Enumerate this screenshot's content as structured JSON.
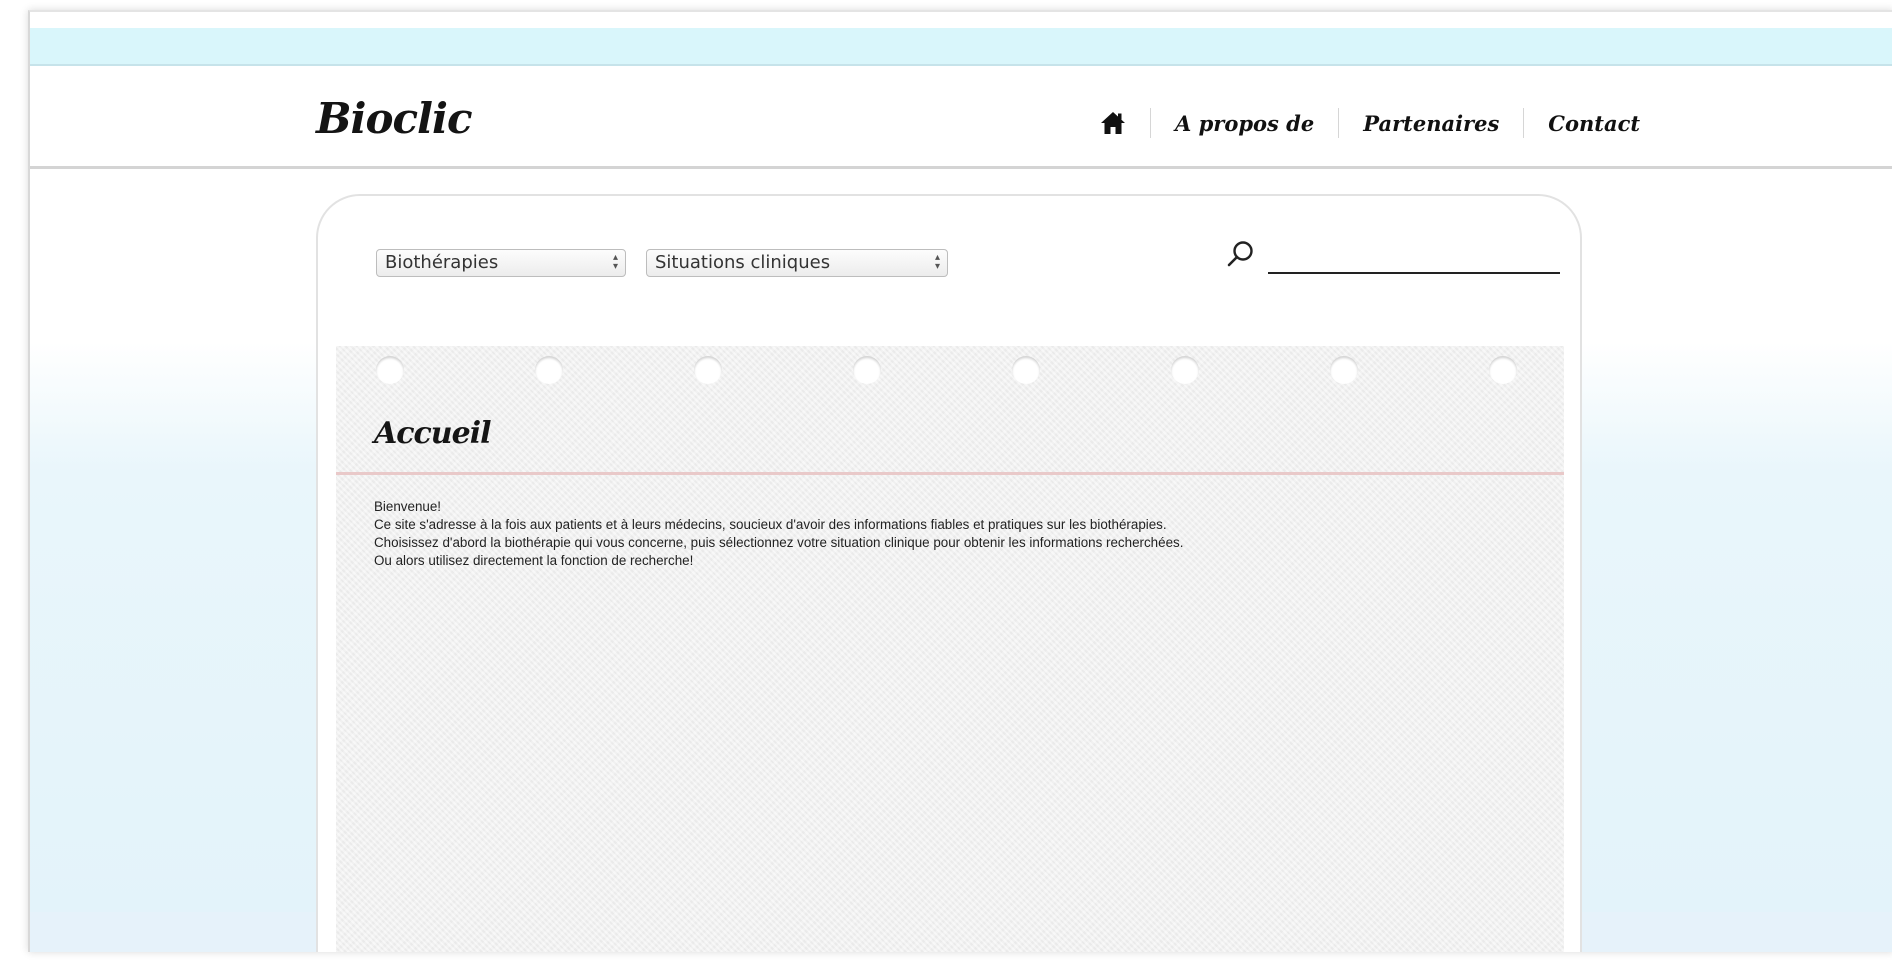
{
  "header": {
    "logo": "Bioclic",
    "nav": [
      {
        "icon": "home-icon"
      },
      {
        "label": "A propos de"
      },
      {
        "label": "Partenaires"
      },
      {
        "label": "Contact"
      }
    ]
  },
  "filters": {
    "therapy_select": "Biothérapies",
    "situation_select": "Situations cliniques",
    "search": {
      "value": "",
      "icon": "search-icon"
    }
  },
  "page": {
    "title": "Accueil",
    "paragraphs": [
      "Bienvenue!",
      "Ce site s'adresse à la fois aux patients et à leurs médecins, soucieux d'avoir des informations fiables et pratiques sur les biothérapies.",
      "Choisissez d'abord la biothérapie qui vous concerne, puis sélectionnez votre situation clinique pour obtenir les informations recherchées.",
      "Ou alors utilisez directement la fonction de recherche!"
    ]
  },
  "colors": {
    "top_strip": "#d9f6fb",
    "background_bottom": "#e3f3fa",
    "paper": "#f1f1f1",
    "margin_rule": "#e9c9c9"
  }
}
